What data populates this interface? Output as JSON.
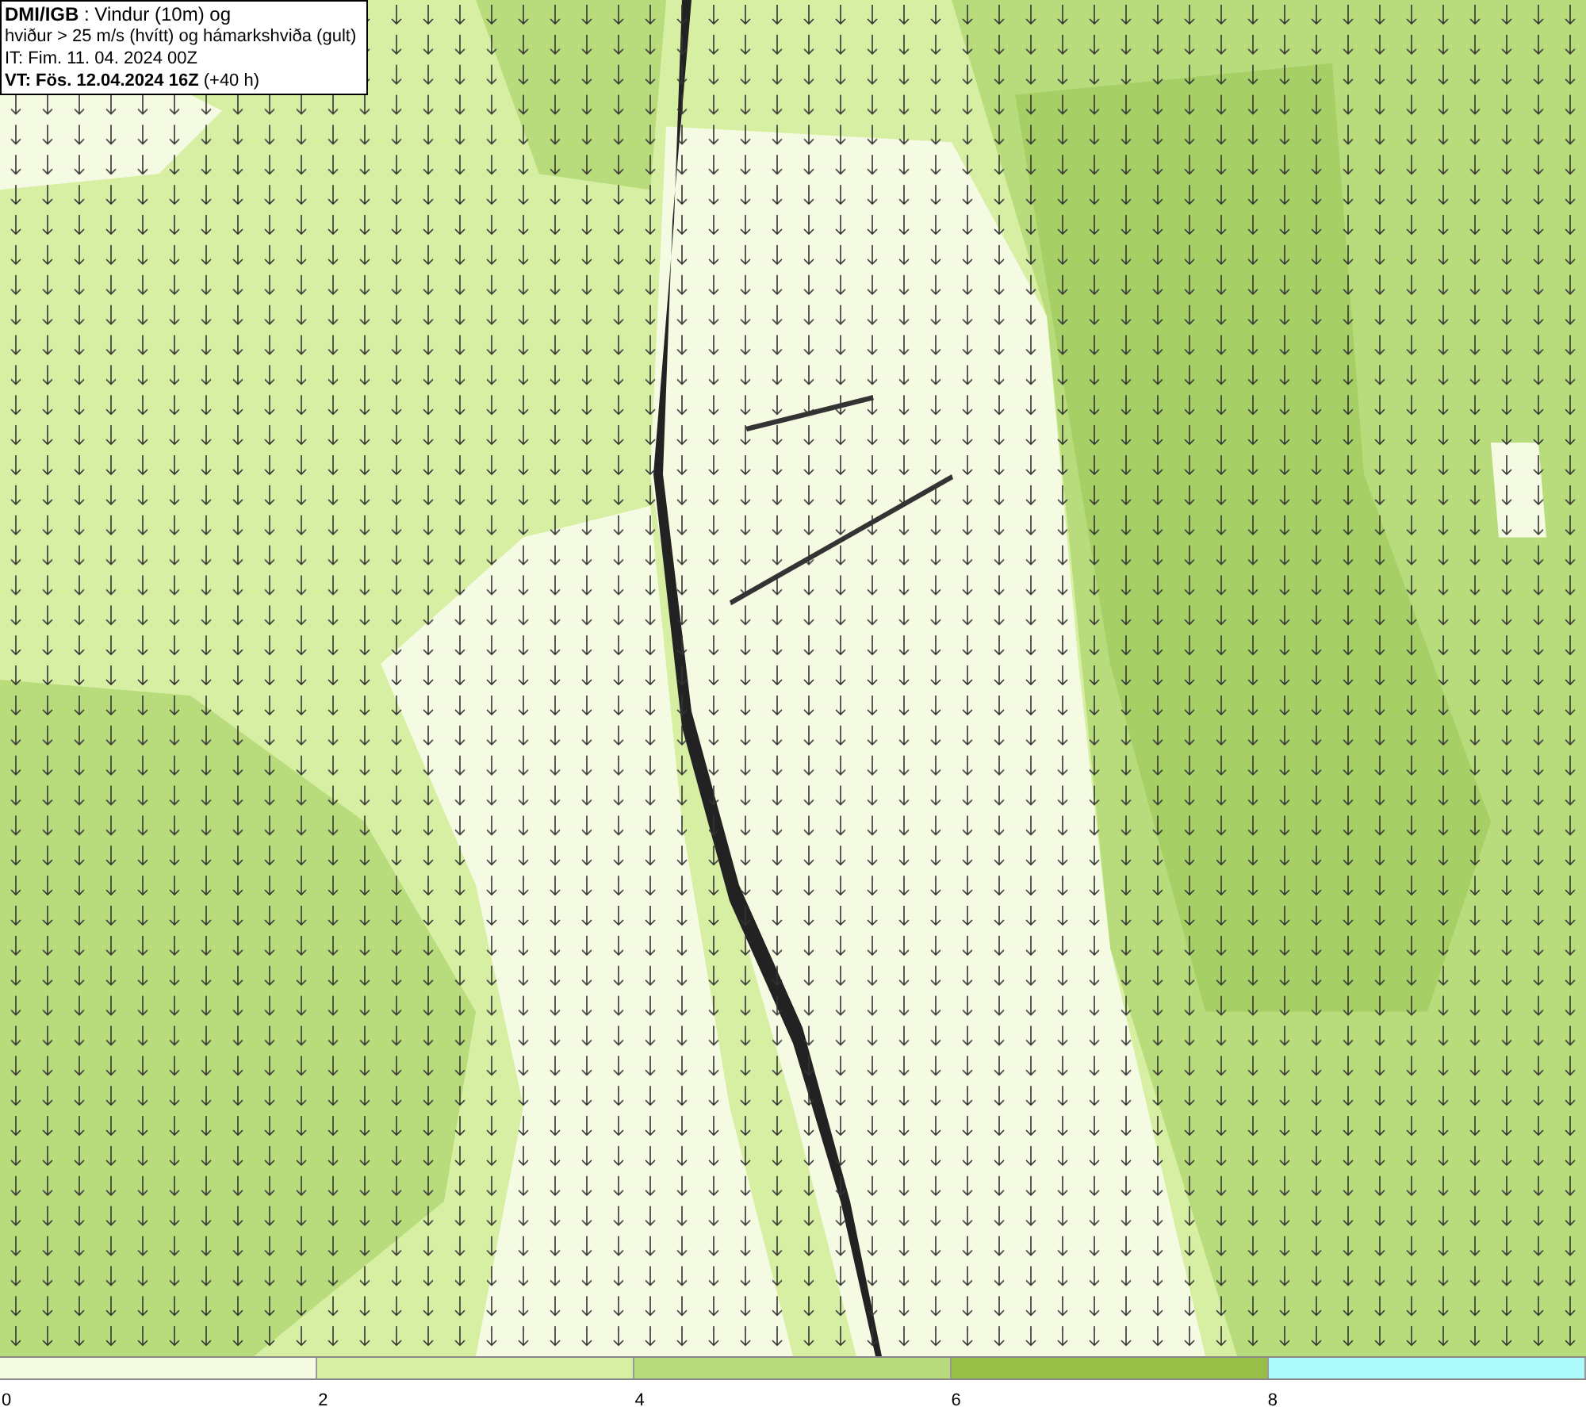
{
  "legend": {
    "lines": [
      "**DMI/IGB** : Vindur (10m) og",
      "hviður > 25 m/s (hvítt) og hámarkshviða (gult)",
      "IT: Fim. 11. 04. 2024 00Z",
      "**VT: Fös. 12.04.2024 16Z** (+40 h)"
    ]
  },
  "color_bar": {
    "segments": [
      {
        "color": "#f5fbe2",
        "label": "0"
      },
      {
        "color": "#d6efa3",
        "label": "2"
      },
      {
        "color": "#b8dc7c",
        "label": "4"
      },
      {
        "color": "#97bf48",
        "label": "6"
      },
      {
        "color": "#adfafa",
        "label": "8"
      }
    ]
  }
}
